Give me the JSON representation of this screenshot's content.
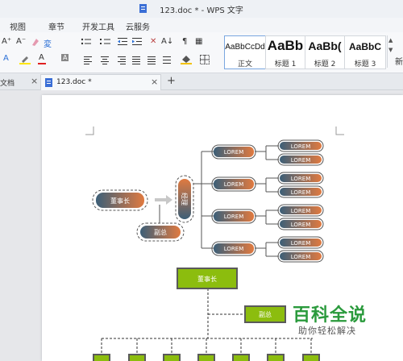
{
  "window": {
    "title": "123.doc * - WPS 文字"
  },
  "menu": {
    "items": [
      "视图",
      "章节",
      "开发工具",
      "云服务"
    ]
  },
  "ribbon": {
    "font_grow": "A⁺",
    "font_shrink": "A⁻",
    "pinyin": "変",
    "styles": [
      {
        "sample": "AaBbCcDd",
        "name": "正文"
      },
      {
        "sample": "AaBb",
        "name": "标题 1"
      },
      {
        "sample": "AaBb(",
        "name": "标题 2"
      },
      {
        "sample": "AaBbC",
        "name": "标题 3"
      },
      {
        "sample": "",
        "name": "新"
      }
    ]
  },
  "tabs": {
    "partial_label": "文档",
    "active_label": "123.doc *",
    "close": "×",
    "new": "+"
  },
  "diagram1": {
    "chairman": "董事长",
    "vice": "副总",
    "manager": "经理",
    "node_label": "LOREM"
  },
  "diagram2": {
    "chairman": "董事长",
    "vice": "副总"
  },
  "watermark": {
    "title": "百科全说",
    "subtitle": "助你轻松解决"
  }
}
